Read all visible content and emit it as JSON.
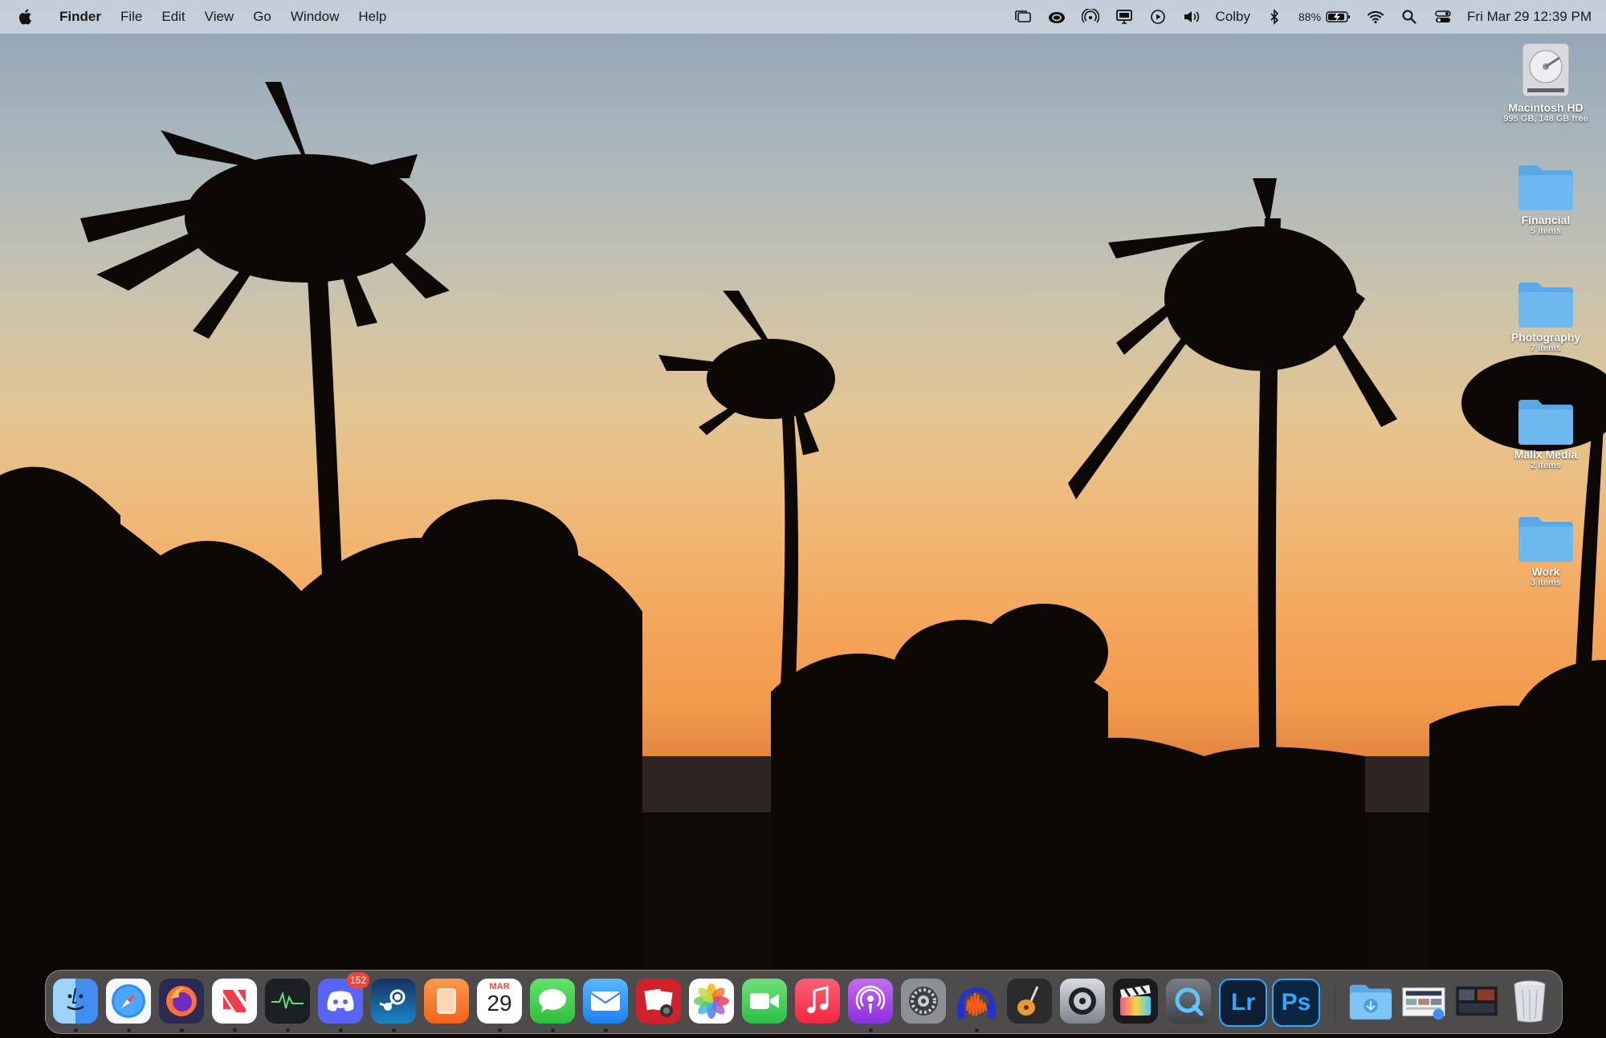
{
  "menubar": {
    "apple_icon": "apple-logo-icon",
    "app_name": "Finder",
    "menus": [
      "File",
      "Edit",
      "View",
      "Go",
      "Window",
      "Help"
    ],
    "status": {
      "user": "Colby",
      "battery_percent": "88%",
      "datetime": "Fri Mar 29  12:39 PM"
    }
  },
  "desktop": {
    "items": [
      {
        "label": "Macintosh HD",
        "sub": "995 GB, 148 GB free",
        "icon": "hard-drive-icon"
      },
      {
        "label": "Financial",
        "sub": "5 items",
        "icon": "folder-icon"
      },
      {
        "label": "Photography",
        "sub": "7 items",
        "icon": "folder-icon"
      },
      {
        "label": "Malix Media",
        "sub": "2 items",
        "icon": "folder-icon"
      },
      {
        "label": "Work",
        "sub": "3 items",
        "icon": "folder-icon"
      }
    ]
  },
  "dock": {
    "discord_badge": "152",
    "calendar_month": "MAR",
    "calendar_day": "29",
    "lr_label": "Lr",
    "ps_label": "Ps"
  },
  "colors": {
    "folder_blue": "#6cb8ef",
    "badge_red": "#f0463a"
  }
}
